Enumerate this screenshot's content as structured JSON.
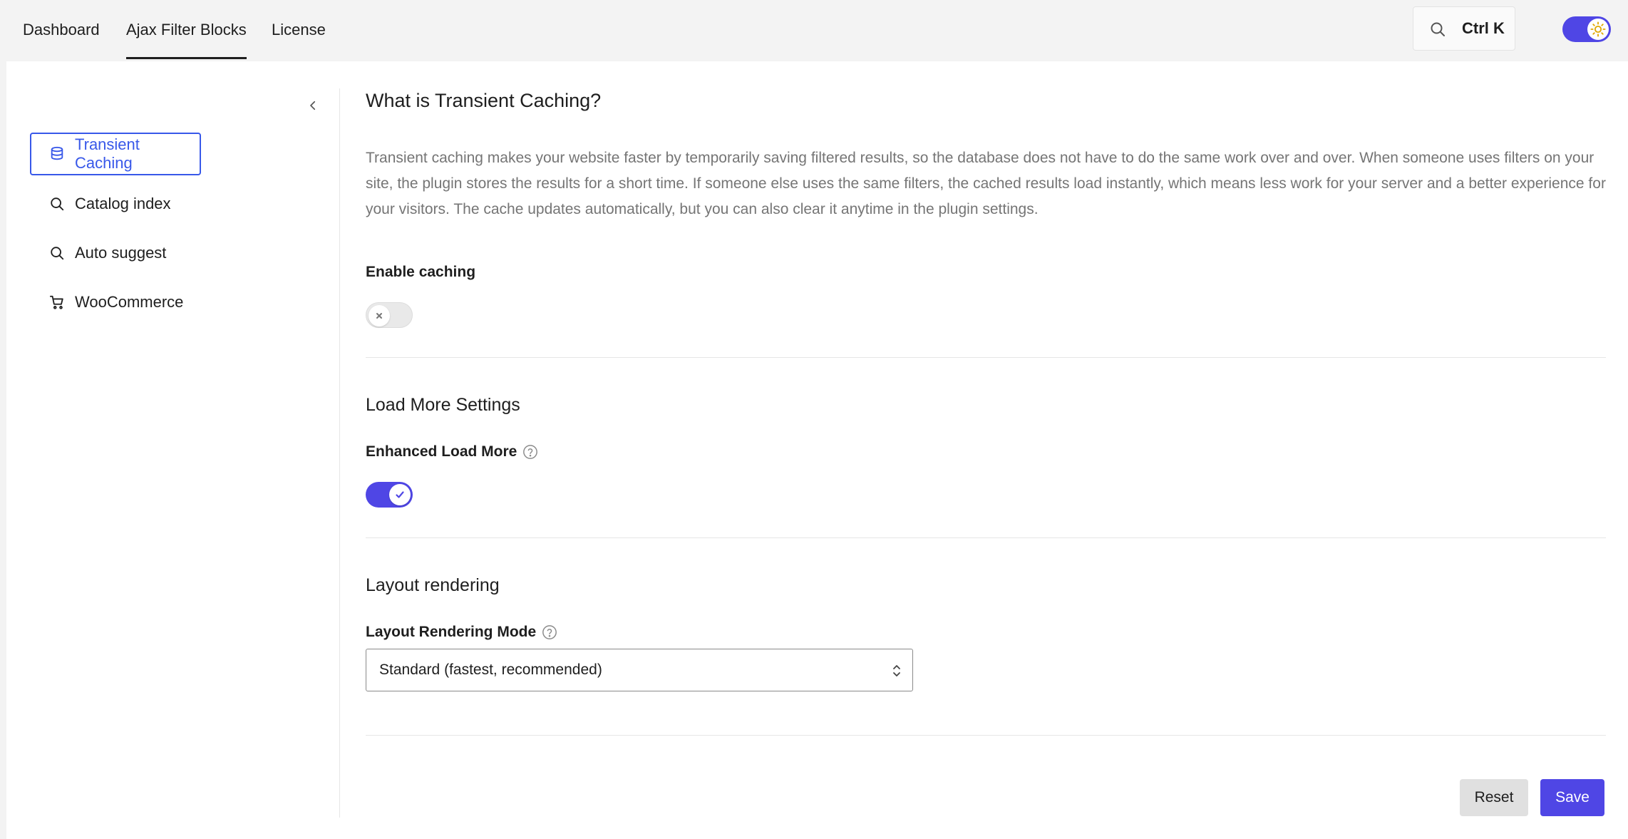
{
  "nav": {
    "tabs": [
      {
        "label": "Dashboard"
      },
      {
        "label": "Ajax Filter Blocks"
      },
      {
        "label": "License"
      }
    ],
    "active_tab": "Ajax Filter Blocks",
    "search": {
      "shortcut": "Ctrl K",
      "icon": "search-icon"
    },
    "theme_toggle": {
      "icon": "sun-icon",
      "state": "on"
    }
  },
  "sidebar": {
    "items": [
      {
        "label": "Transient Caching",
        "icon": "database-icon",
        "active": true
      },
      {
        "label": "Catalog index",
        "icon": "search-icon"
      },
      {
        "label": "Auto suggest",
        "icon": "search-icon"
      },
      {
        "label": "WooCommerce",
        "icon": "cart-icon"
      }
    ]
  },
  "main": {
    "title": "What is Transient Caching?",
    "description": "Transient caching makes your website faster by temporarily saving filtered results, so the database does not have to do the same work over and over. When someone uses filters on your site, the plugin stores the results for a short time. If someone else uses the same filters, the cached results load instantly, which means less work for your server and a better experience for your visitors. The cache updates automatically, but you can also clear it anytime in the plugin settings.",
    "enable_caching": {
      "label": "Enable caching",
      "value": false
    },
    "load_more": {
      "section_title": "Load More Settings",
      "enhanced_label": "Enhanced Load More",
      "value": true
    },
    "layout": {
      "section_title": "Layout rendering",
      "mode_label": "Layout Rendering Mode",
      "selected": "Standard (fastest, recommended)"
    }
  },
  "actions": {
    "reset_label": "Reset",
    "save_label": "Save"
  },
  "colors": {
    "accent": "#4f46e5",
    "active_link": "#3858e9",
    "muted_text": "#757575"
  }
}
